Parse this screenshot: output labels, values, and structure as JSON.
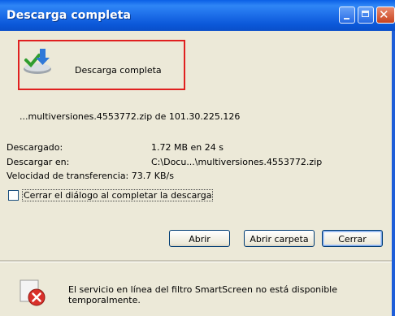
{
  "window": {
    "title": "Descarga completa"
  },
  "header": {
    "status_text": "Descarga completa"
  },
  "download": {
    "file_line": "...multiversiones.4553772.zip de 101.30.225.126",
    "downloaded_label": "Descargado:",
    "downloaded_value": "1.72 MB en 24 s",
    "saved_to_label": "Descargar en:",
    "saved_to_value": "C:\\Docu...\\multiversiones.4553772.zip",
    "speed_text": "Velocidad de transferencia: 73.7 KB/s"
  },
  "options": {
    "close_on_complete_label": "Cerrar el diálogo al completar la descarga",
    "close_on_complete_checked": false
  },
  "buttons": {
    "open_label": "Abrir",
    "open_folder_label": "Abrir carpeta",
    "close_label": "Cerrar"
  },
  "smartscreen": {
    "message": "El servicio en línea del filtro SmartScreen no está disponible temporalmente."
  },
  "icons": {
    "download_complete": "download-complete-icon",
    "error": "error-icon"
  },
  "colors": {
    "titlebar": "#0a5fe6",
    "highlight_border": "#e02020",
    "dialog_bg": "#ece9d8",
    "error_red": "#d9302a"
  }
}
